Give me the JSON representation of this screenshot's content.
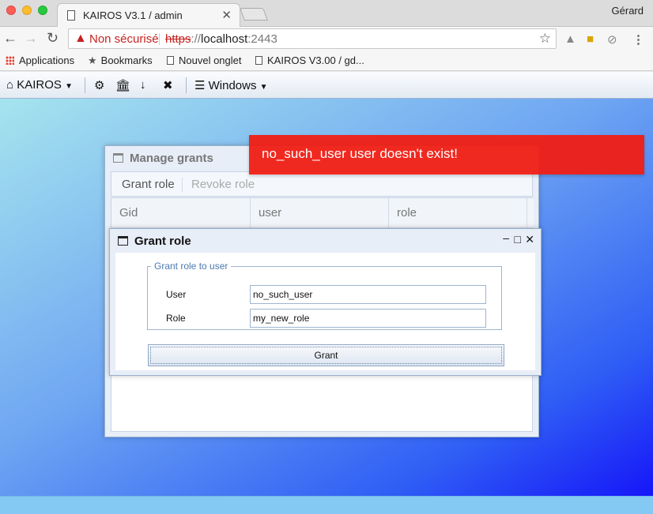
{
  "browser": {
    "tab_title": "KAIROS V3.1 / admin",
    "tab_close": "✕",
    "profile_name": "Gérard",
    "security_label": "Non sécurisé",
    "url_scheme": "https",
    "url_separator": "://",
    "url_host": "localhost",
    "url_port": ":2443",
    "bookmarks": [
      {
        "label": "Applications",
        "icon": "apps-grid-icon"
      },
      {
        "label": "Bookmarks",
        "icon": "star-icon"
      },
      {
        "label": "Nouvel onglet",
        "icon": "page-icon"
      },
      {
        "label": "KAIROS V3.00 / gd...",
        "icon": "page-icon"
      }
    ]
  },
  "toolbar": {
    "home_label": "KAIROS",
    "windows_label": "Windows"
  },
  "manage_grants": {
    "title": "Manage grants",
    "tabs": [
      "Grant role",
      "Revoke role"
    ],
    "columns": [
      "Gid",
      "user",
      "role"
    ]
  },
  "grant_role": {
    "title": "Grant role",
    "legend": "Grant role to user",
    "user_label": "User",
    "user_value": "no_such_user",
    "role_label": "Role",
    "role_value": "my_new_role",
    "button_label": "Grant"
  },
  "toast": {
    "message": "no_such_user user doesn't exist!",
    "color": "#f01e14"
  }
}
